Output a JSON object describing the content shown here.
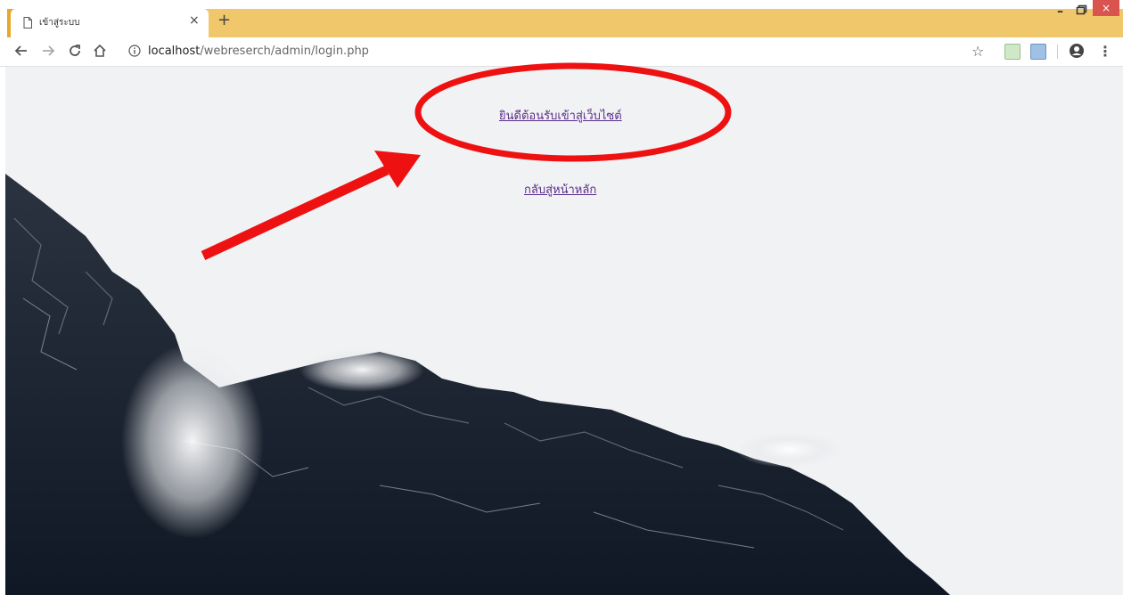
{
  "browser": {
    "tab": {
      "title": "เข้าสู่ระบบ",
      "close_label": "×"
    },
    "new_tab_label": "+",
    "window_controls": {
      "minimize_label": "–",
      "close_label": "×"
    },
    "address_bar": {
      "host": "localhost",
      "path": "/webreserch/admin/login.php"
    },
    "icons": {
      "back": "back-arrow-icon",
      "forward": "forward-arrow-icon",
      "reload": "reload-icon",
      "home": "home-icon",
      "info": "info-icon",
      "bookmark": "star-icon",
      "account": "account-icon",
      "menu": "kebab-menu-icon"
    }
  },
  "page": {
    "welcome_link": "ยินดีต้อนรับเข้าสู่เว็บไซต์",
    "home_link": "กลับสู่หน้าหลัก"
  },
  "colors": {
    "tabstrip": "#f1c76b",
    "link": "#5a2d8a",
    "annotation": "#ee1111",
    "page_bg": "#f1f2f4",
    "mountain": "#16202e"
  }
}
